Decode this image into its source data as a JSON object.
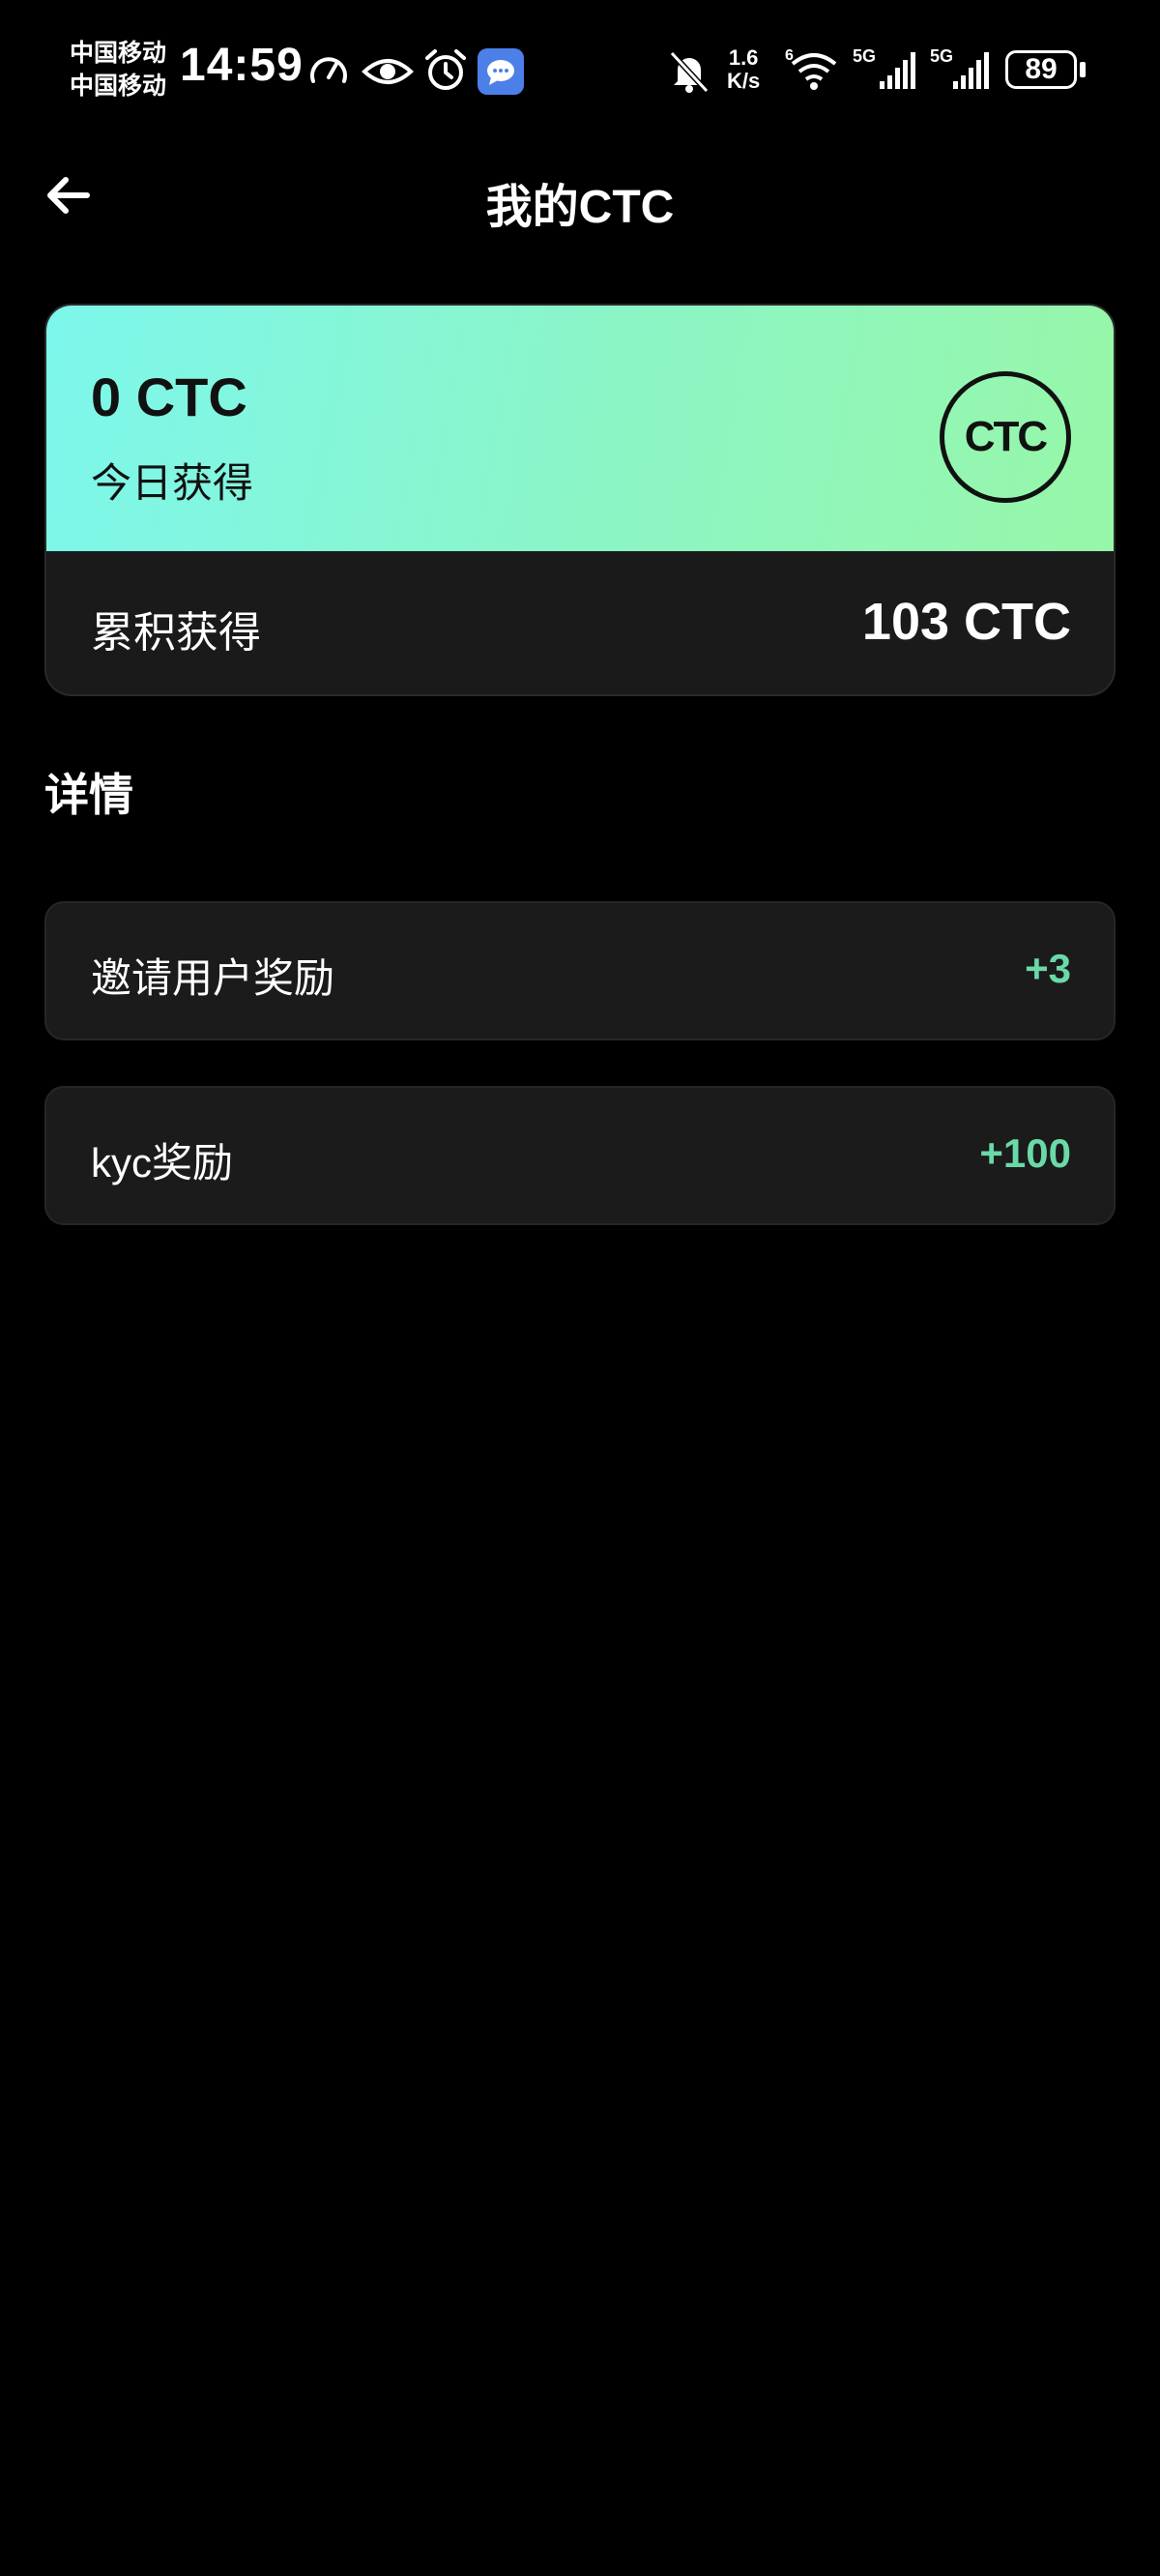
{
  "status_bar": {
    "carrier_1": "中国移动",
    "carrier_2": "中国移动",
    "time": "14:59",
    "net_speed_value": "1.6",
    "net_speed_unit": "K/s",
    "wifi_badge": "6",
    "signal_1_label": "5G",
    "signal_2_label": "5G",
    "battery": "89",
    "icons": [
      "speedometer-icon",
      "eye-icon",
      "alarm-icon",
      "message-icon",
      "bell-muted-icon",
      "wifi-icon",
      "signal-icon",
      "signal-icon",
      "battery-icon"
    ]
  },
  "header": {
    "title": "我的CTC",
    "back_icon": "arrow-left-icon"
  },
  "summary": {
    "today_amount": "0 CTC",
    "today_label": "今日获得",
    "logo_text": "CTC",
    "total_label": "累积获得",
    "total_value": "103 CTC",
    "gradient_colors": [
      "#7df7ec",
      "#97f7a8"
    ]
  },
  "details": {
    "title": "详情",
    "items": [
      {
        "label": "邀请用户奖励",
        "value": "+3"
      },
      {
        "label": "kyc奖励",
        "value": "+100"
      }
    ],
    "value_color": "#6ad9a8"
  }
}
